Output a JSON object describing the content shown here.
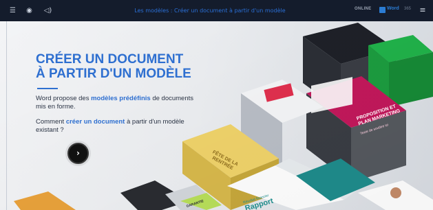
{
  "topbar": {
    "title": "Les modèles : Créer un document à partir d'un modèle",
    "online_label": "ONLINE",
    "app_name": "Word",
    "version": "365",
    "icons": [
      "menu-icon",
      "location-icon",
      "volume-icon",
      "hamburger-icon"
    ]
  },
  "hero": {
    "title_line1": "CRÉER UN DOCUMENT",
    "title_line2": "À PARTIR D'UN MODÈLE",
    "p1_pre": "Word propose des ",
    "p1_em": "modèles prédéfinis",
    "p1_post": " de documents mis en forme.",
    "p2_pre": "Comment ",
    "p2_em": "créer un document",
    "p2_post": " à partir d'un modèle existant ?",
    "play_glyph": "›"
  },
  "documents": {
    "marketing_title": "PROPOSITION ET PLAN MARKETING",
    "marketing_sub": "Texte de soutitre ici",
    "yellow_title": "FÊTE DE LA RENTRÉE",
    "report_pre": "Résultat financier",
    "report_title": "Rapport",
    "green_tag": "GARANTIE"
  },
  "colors": {
    "accent": "#2e6fd0",
    "topbar": "#141c2c",
    "marketing": "#c2185b",
    "yellow": "#f0d36a",
    "teal": "#1f8c8c"
  }
}
